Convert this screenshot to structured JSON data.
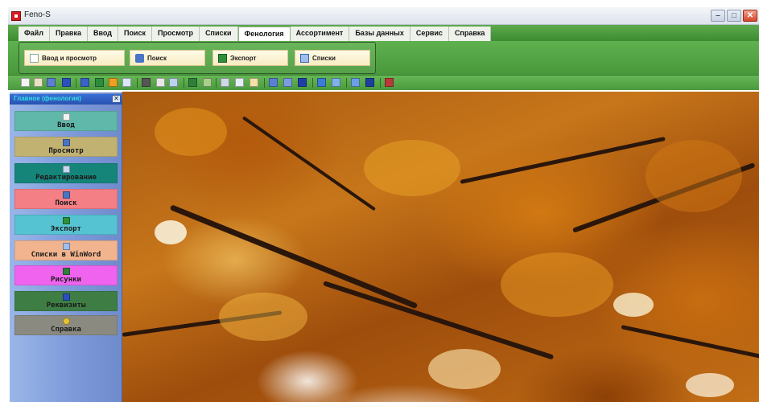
{
  "window": {
    "title": "Feno-S",
    "controls": {
      "minimize": "–",
      "maximize": "□",
      "close": "✕"
    }
  },
  "menu": {
    "tabs": [
      "Файл",
      "Правка",
      "Ввод",
      "Поиск",
      "Просмотр",
      "Списки",
      "Фенология",
      "Ассортимент",
      "Базы данных",
      "Сервис",
      "Справка"
    ],
    "active": "Фенология"
  },
  "ribbon": {
    "buttons": [
      {
        "label": "Ввод и просмотр",
        "icon": "document-icon"
      },
      {
        "label": "Поиск",
        "icon": "binoculars-icon"
      },
      {
        "label": "Экспорт",
        "icon": "excel-icon"
      },
      {
        "label": "Списки",
        "icon": "list-icon"
      }
    ]
  },
  "toolbar": {
    "icons": [
      "new-document-icon",
      "open-icon",
      "find-icon",
      "tool-icon",
      "table-icon",
      "grid-icon",
      "image-icon",
      "text-icon",
      "calendar-icon",
      "check-icon",
      "print-icon",
      "layout-icon",
      "copy-icon",
      "cut-icon",
      "paste-icon",
      "paste-special-icon",
      "undo-icon",
      "redo-icon",
      "save-icon",
      "globe-icon",
      "help-icon",
      "window-icon",
      "blue-window-icon",
      "stop-icon"
    ]
  },
  "side_panel": {
    "title": "Главное (фенология)",
    "close": "✕",
    "buttons": [
      {
        "label": "Ввод",
        "color": "#5fb8a9",
        "icon": "document-icon"
      },
      {
        "label": "Просмотр",
        "color": "#c2b272",
        "icon": "binoculars-icon"
      },
      {
        "label": "Редактирование",
        "color": "#15857a",
        "icon": "edit-icon"
      },
      {
        "label": "Поиск",
        "color": "#f47f84",
        "icon": "binoculars-icon"
      },
      {
        "label": "Экспорт",
        "color": "#56c3d2",
        "icon": "excel-icon"
      },
      {
        "label": "Списки в WinWord",
        "color": "#f2b48e",
        "icon": "list-icon"
      },
      {
        "label": "Рисунки",
        "color": "#ef63ef",
        "icon": "picture-icon"
      },
      {
        "label": "Реквизиты",
        "color": "#3e7d44",
        "icon": "requisites-icon"
      },
      {
        "label": "Справка",
        "color": "#8a8a80",
        "icon": "help-icon"
      }
    ]
  },
  "colors": {
    "menu_green": "#4a9a3e",
    "panel_blue": "#7c98d8",
    "panel_title": "#33e0e6"
  },
  "main_image": {
    "description_icon": "autumn-leaves-image"
  }
}
